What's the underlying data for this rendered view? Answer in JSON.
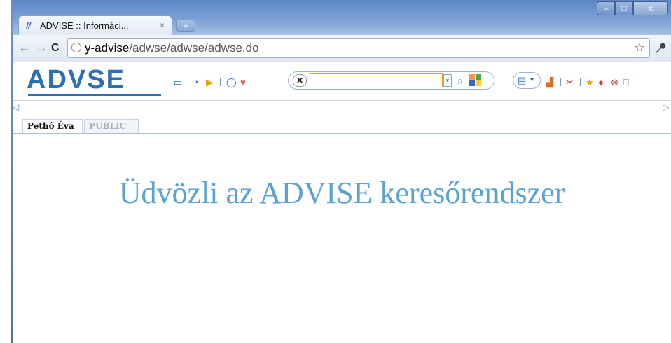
{
  "browser": {
    "tab_title": "ADVISE :: Informáci...",
    "tab_close": "×",
    "new_tab": "+",
    "window_controls": {
      "minimize": "–",
      "maximize": "□",
      "close": "x"
    },
    "nav": {
      "back": "←",
      "forward": "→",
      "reload": "C"
    },
    "url_host": "y-advise",
    "url_path": "/adwse/adwse/adwse.do",
    "star": "☆",
    "wrench": "🔧"
  },
  "app": {
    "logo": "ADVSE",
    "search": {
      "clear": "✕",
      "value": "",
      "dropdown": "▾",
      "search_icon": "⌕"
    },
    "doc_buttons": {
      "doc": "▤",
      "dropdown": "▾"
    }
  },
  "tabs": [
    {
      "label": "Pethő Éva",
      "active": true
    },
    {
      "label": "PUBLIC",
      "active": false
    }
  ],
  "main": {
    "welcome": "Üdvözli az ADVISE keresőrendszer"
  },
  "colors": {
    "brand": "#2a6fb8",
    "welcome": "#5aa2cf",
    "titlebar": "#7fa3d6"
  }
}
